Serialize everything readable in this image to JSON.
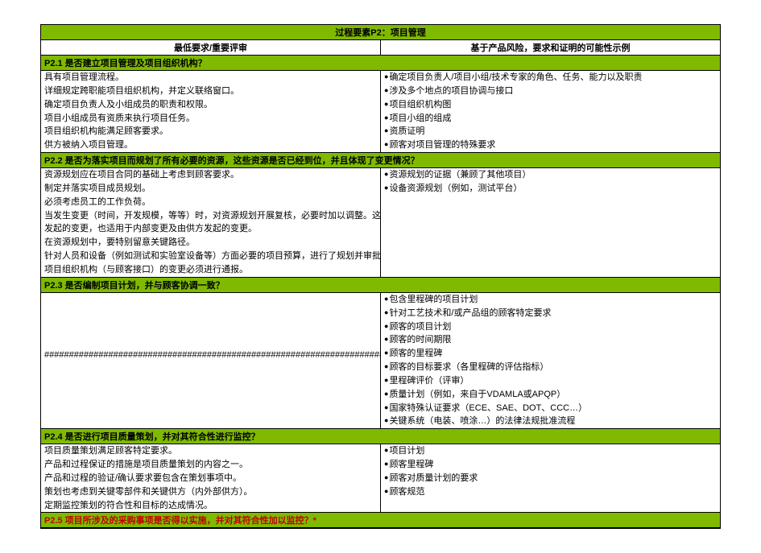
{
  "header": {
    "title": "过程要素P2：项目管理",
    "col1": "最低要求/重要评审",
    "col2": "基于产品风险，要求和证明的可能性示例"
  },
  "sections": [
    {
      "title": "P2.1  是否建立项目管理及项目组织机构？",
      "left": [
        "具有项目管理流程。",
        "详细规定跨职能项目组织机构，并定义联络窗口。",
        "确定项目负责人及小组成员的职责和权限。",
        "项目小组成员有资质来执行项目任务。",
        "项目组织机构能满足顾客要求。",
        "供方被纳入项目管理。"
      ],
      "right_bulleted": [
        "确定项目负责人/项目小组/技术专家的角色、任务、能力以及职责",
        "涉及多个地点的项目协调与接口",
        "项目组织机构图",
        "项目小组的组成",
        "资质证明",
        "顾客对项目管理的特殊要求"
      ]
    },
    {
      "title": "P2.2  是否为落实项目而规划了所有必要的资源，这些资源是否已经到位，并且体现了变更情况？",
      "left": [
        "资源规划应在项目合同的基础上考虑到顾客要求。",
        "制定并落实项目成员规划。",
        "必须考虑员工的工作负荷。",
        "当发生变更（时间，开发规模，等等）时，对资源规划开展复核，必要时加以调整。这既适用于由顾客",
        "发起的变更，也适用于内部变更及由供方发起的变更。",
        "在资源规划中，要特别留意关键路径。",
        "针对人员和设备（例如测试和实验室设备等）方面必要的项目预算，进行了规划并审批通过。",
        "项目组织机构（与顾客接口）的变更必须进行通报。"
      ],
      "right_bulleted": [
        "资源规划的证据（兼顾了其他项目）",
        "设备资源规划（例如，测试平台）"
      ]
    },
    {
      "title": "P2.3  是否编制项目计划，并与顾客协调一致？",
      "left_hash_rows": 1,
      "right_bulleted": [
        "包含里程碑的项目计划",
        "针对工艺技术和/或产品组的顾客特定要求",
        "顾客的项目计划",
        "顾客的时间期限",
        "顾客的里程碑",
        "顾客的目标要求（各里程碑的评估指标）",
        "里程碑评价（评审）",
        "质量计划（例如，来自于VDAMLA或APQP）",
        "国家特殊认证要求（ECE、SAE、DOT、CCC…）",
        "关键系统（电装、喷涂…）的法律法规批准流程"
      ]
    },
    {
      "title": "P2.4  是否进行项目质量策划，并对其符合性进行监控？",
      "left": [
        "项目质量策划满足顾客特定要求。",
        "产品和过程保证的措施是项目质量策划的内容之一。",
        "产品和过程的验证/确认要求要包含在策划事项中。",
        "策划也考虑到关键零部件和关键供方（内外部供方）。",
        "定期监控策划的符合性和目标的达成情况。"
      ],
      "right_bulleted": [
        "项目计划",
        "顾客里程碑",
        "顾客对质量计划的要求",
        "顾客规范"
      ]
    },
    {
      "title": "P2.5  项目所涉及的采购事项是否得以实施，并对其符合性加以监控？*",
      "red": true,
      "left": [],
      "right_bulleted": []
    }
  ]
}
